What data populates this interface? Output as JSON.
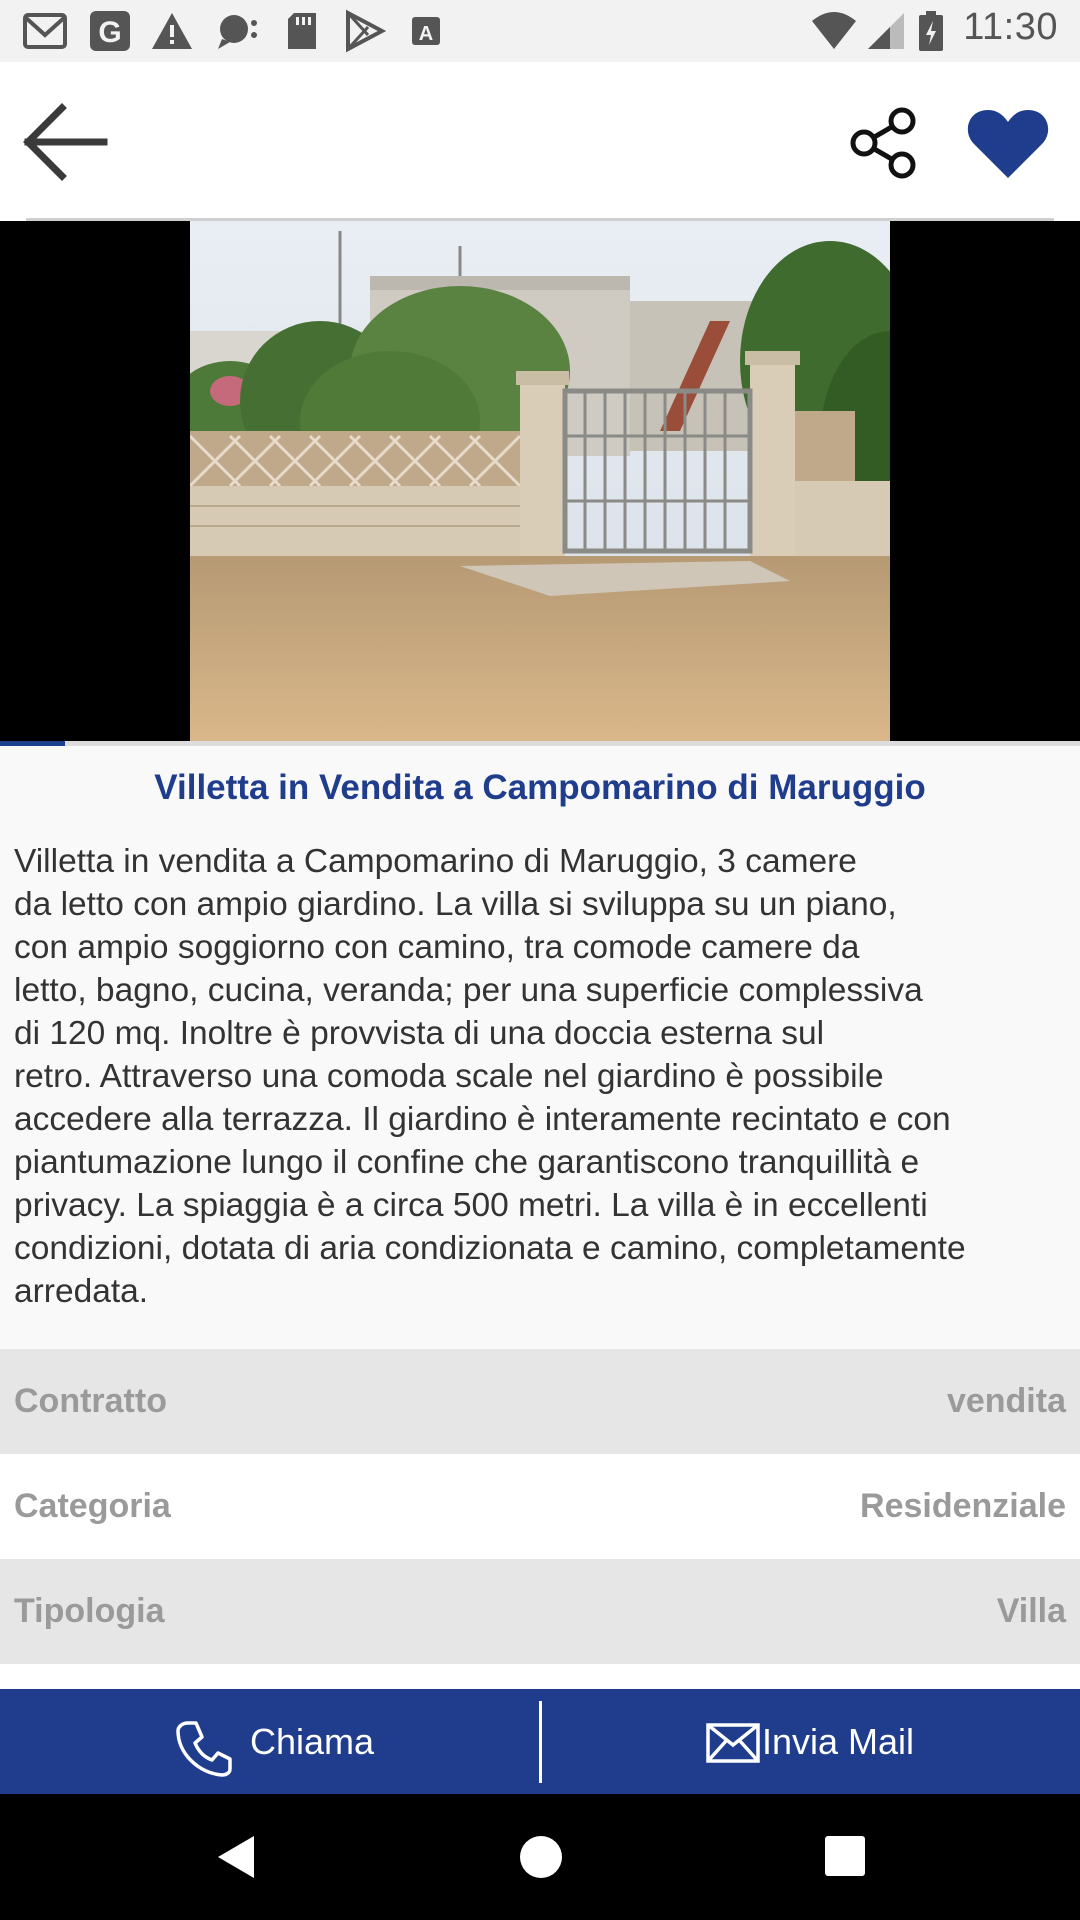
{
  "status_bar": {
    "time": "11:30",
    "left_icons": [
      "gmail-icon",
      "google-icon",
      "warning-icon",
      "chat-bubble-icon",
      "sd-card-icon",
      "play-store-icon",
      "font-icon"
    ],
    "right_icons": [
      "wifi-icon",
      "cell-signal-icon",
      "battery-icon"
    ]
  },
  "app_bar": {
    "back_icon": "arrow-left-icon",
    "share_icon": "share-icon",
    "favorite_icon": "heart-icon"
  },
  "gallery": {
    "image_description": "villa-photo",
    "progress_fraction": 0.06
  },
  "listing": {
    "title": "Villetta in Vendita a Campomarino di Maruggio",
    "description_lines": [
      "Villetta in vendita a Campomarino di Maruggio, 3 camere",
      "da letto con ampio giardino. La villa si sviluppa su un piano,",
      "con ampio soggiorno con camino, tra comode camere da",
      "letto, bagno, cucina, veranda; per una superficie complessiva",
      "di 120 mq. Inoltre è provvista di una doccia esterna sul",
      "retro. Attraverso una comoda scale nel giardino è possibile",
      "accedere alla terrazza. Il giardino è interamente recintato e con",
      "piantumazione lungo il confine che garantiscono tranquillità e",
      "privacy. La spiaggia è a circa 500 metri. La villa è in eccellenti",
      "condizioni, dotata di aria condizionata e camino, completamente",
      "arredata."
    ]
  },
  "details": [
    {
      "label": "Contratto",
      "value": "vendita"
    },
    {
      "label": "Categoria",
      "value": "Residenziale"
    },
    {
      "label": "Tipologia",
      "value": "Villa"
    }
  ],
  "actions": {
    "call_label": "Chiama",
    "call_icon": "phone-icon",
    "mail_label": "Invia Mail",
    "mail_icon": "mail-icon"
  },
  "colors": {
    "brand_blue": "#1f3d8c",
    "muted_gray": "#9a9a9a",
    "shaded_row": "#e6e6e6"
  }
}
